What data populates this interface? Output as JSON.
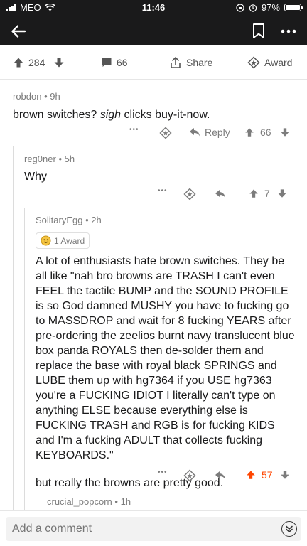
{
  "status": {
    "carrier": "MEO",
    "time": "11:46",
    "battery": "97%"
  },
  "post_bar": {
    "upvotes": "284",
    "comments": "66",
    "share_label": "Share",
    "award_label": "Award"
  },
  "comments": [
    {
      "author": "robdon",
      "age": "9h",
      "body_pre": "brown switches? ",
      "body_em": "sigh",
      "body_post": " clicks buy-it-now.",
      "reply_label": "Reply",
      "score": "66"
    },
    {
      "author": "reg0ner",
      "age": "5h",
      "body": "Why",
      "score": "7"
    },
    {
      "author": "SolitaryEgg",
      "age": "2h",
      "award": "1 Award",
      "body": "A lot of enthusiasts hate brown switches. They be all like \"nah bro browns are TRASH I can't even FEEL the tactile BUMP and the SOUND PROFILE is so God damned MUSHY you have to fucking go to MASSDROP and wait for 8 fucking YEARS after pre-ordering the zeelios burnt navy translucent blue box panda ROYALS then de-solder them and replace the base with royal black SPRINGS and LUBE them up with hg7364 if you USE hg7363 you're a FUCKING IDIOT I literally can't type on anything ELSE because everything else is FUCKING TRASH and RGB is for fucking KIDS and I'm a fucking ADULT that collects fucking KEYBOARDS.\"",
      "body2": "but really the browns are pretty good.",
      "score": "57"
    },
    {
      "author": "crucial_popcorn",
      "age": "1h"
    }
  ],
  "separator": "•",
  "more_dots": "•••",
  "bottom": {
    "placeholder": "Add a comment"
  },
  "colors": {
    "upvote_active": "#ff4500",
    "header_bg": "#1a1a1b"
  }
}
